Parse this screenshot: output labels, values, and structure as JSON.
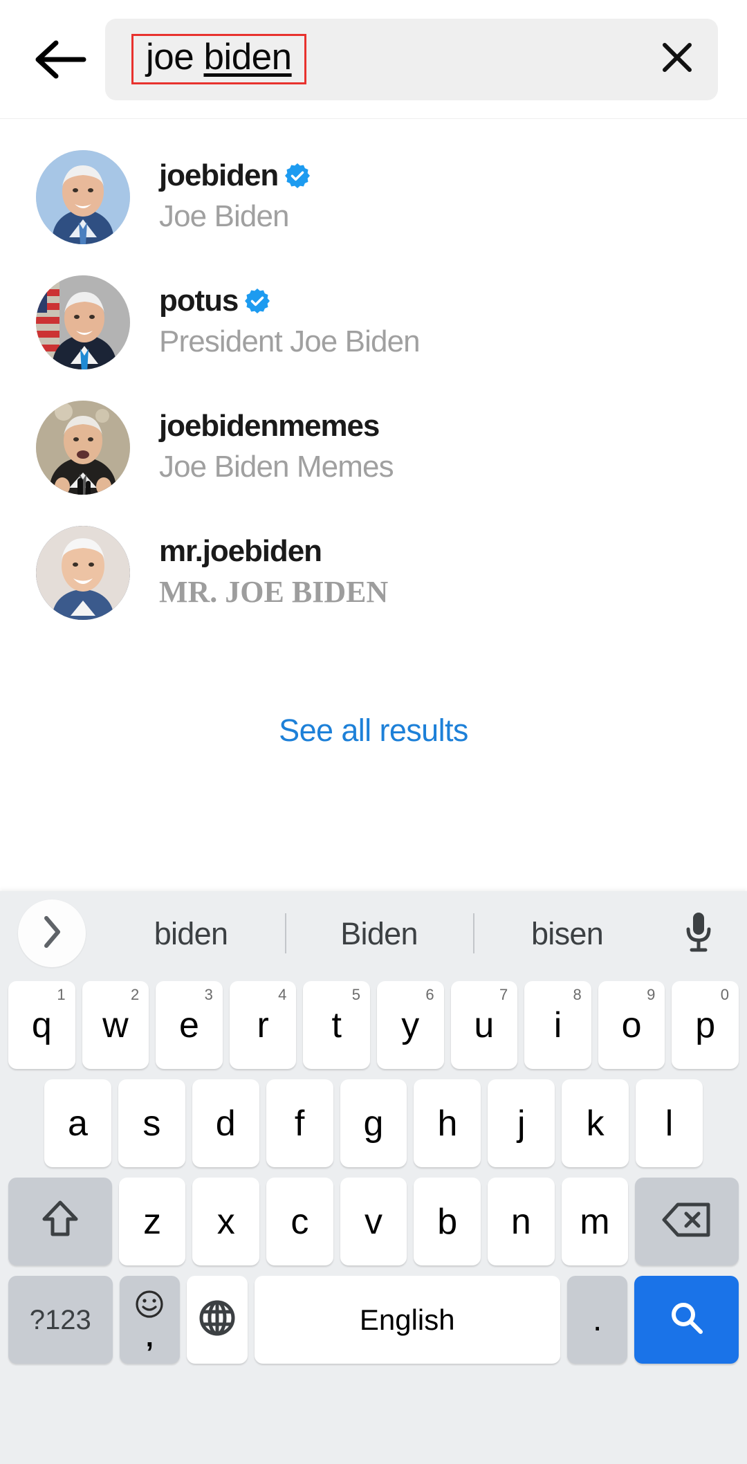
{
  "app": "instagram-search",
  "search": {
    "query_prefix": "joe ",
    "query_composing": "biden",
    "full_query": "joe biden",
    "back_icon": "arrow-left-icon",
    "clear_icon": "close-icon",
    "highlight_color": "#e8322e",
    "field_bg": "#efefef"
  },
  "results": [
    {
      "username": "joebiden",
      "fullname": "Joe Biden",
      "verified": true,
      "avatar": "joe-biden-blue-background-portrait",
      "name_style": "sans"
    },
    {
      "username": "potus",
      "fullname": "President Joe Biden",
      "verified": true,
      "avatar": "joe-biden-flag-background-portrait",
      "name_style": "sans"
    },
    {
      "username": "joebidenmemes",
      "fullname": "Joe Biden Memes",
      "verified": false,
      "avatar": "joe-biden-speaking-portrait",
      "name_style": "sans"
    },
    {
      "username": "mr.joebiden",
      "fullname": "MR. JOE BIDEN",
      "verified": false,
      "avatar": "joe-biden-smiling-portrait",
      "name_style": "serif"
    }
  ],
  "see_all": {
    "label": "See all results",
    "color": "#1d80d8"
  },
  "keyboard": {
    "expand_icon": "chevron-right-icon",
    "mic_icon": "microphone-icon",
    "suggestions": [
      "biden",
      "Biden",
      "bisen"
    ],
    "row1": [
      {
        "label": "q",
        "num": "1"
      },
      {
        "label": "w",
        "num": "2"
      },
      {
        "label": "e",
        "num": "3"
      },
      {
        "label": "r",
        "num": "4"
      },
      {
        "label": "t",
        "num": "5"
      },
      {
        "label": "y",
        "num": "6"
      },
      {
        "label": "u",
        "num": "7"
      },
      {
        "label": "i",
        "num": "8"
      },
      {
        "label": "o",
        "num": "9"
      },
      {
        "label": "p",
        "num": "0"
      }
    ],
    "row2": [
      {
        "label": "a"
      },
      {
        "label": "s"
      },
      {
        "label": "d"
      },
      {
        "label": "f"
      },
      {
        "label": "g"
      },
      {
        "label": "h"
      },
      {
        "label": "j"
      },
      {
        "label": "k"
      },
      {
        "label": "l"
      }
    ],
    "row3": [
      {
        "label": "z"
      },
      {
        "label": "x"
      },
      {
        "label": "c"
      },
      {
        "label": "v"
      },
      {
        "label": "b"
      },
      {
        "label": "n"
      },
      {
        "label": "m"
      }
    ],
    "shift_icon": "shift-up-arrow-icon",
    "backspace_icon": "backspace-delete-icon",
    "symbols_label": "?123",
    "emoji_icon": "smiley-face-icon",
    "emoji_secondary": ",",
    "globe_icon": "globe-language-icon",
    "space_label": "English",
    "period_label": ".",
    "enter_icon": "search-magnifier-icon",
    "enter_color": "#1a73e8",
    "key_bg": "#ffffff",
    "fn_key_bg": "#c8ccd2",
    "keyboard_bg": "#eceef0"
  }
}
